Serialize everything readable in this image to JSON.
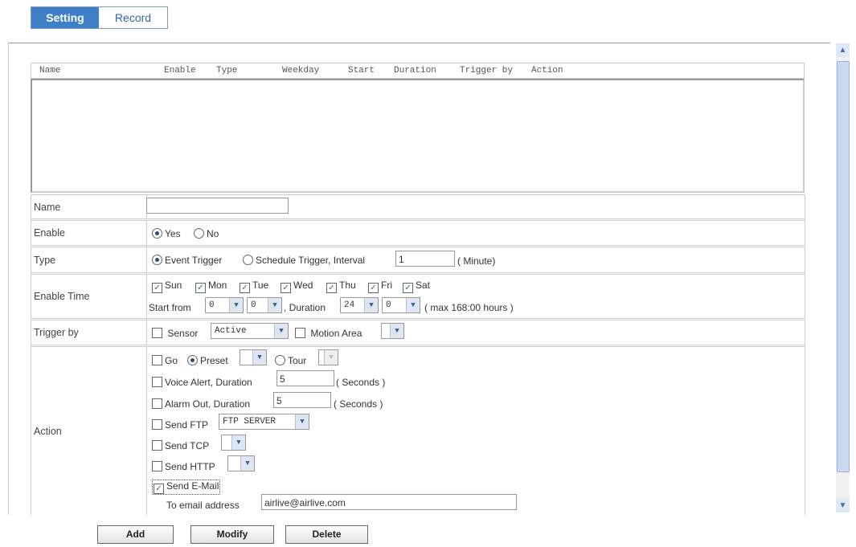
{
  "tabs": {
    "setting": "Setting",
    "record": "Record"
  },
  "list_header": {
    "name": "Name",
    "enable": "Enable",
    "type": "Type",
    "weekday": "Weekday",
    "start": "Start",
    "duration": "Duration",
    "trigger_by": "Trigger by",
    "action": "Action"
  },
  "form": {
    "name": {
      "label": "Name",
      "value": ""
    },
    "enable": {
      "label": "Enable",
      "yes": "Yes",
      "no": "No",
      "selected": "Yes"
    },
    "type": {
      "label": "Type",
      "event": "Event Trigger",
      "schedule": "Schedule Trigger, Interval",
      "interval_value": "1",
      "unit": "( Minute)",
      "selected": "Event Trigger"
    },
    "enable_time": {
      "label": "Enable Time",
      "days": [
        {
          "label": "Sun",
          "checked": true
        },
        {
          "label": "Mon",
          "checked": true
        },
        {
          "label": "Tue",
          "checked": true
        },
        {
          "label": "Wed",
          "checked": true
        },
        {
          "label": "Thu",
          "checked": true
        },
        {
          "label": "Fri",
          "checked": true
        },
        {
          "label": "Sat",
          "checked": true
        }
      ],
      "start_from": "Start from",
      "start_hour": "0",
      "start_min": "0",
      "duration_label": ", Duration",
      "duration_hour": "24",
      "duration_min": "0",
      "max_note": "( max 168:00 hours )"
    },
    "trigger_by": {
      "label": "Trigger by",
      "sensor": "Sensor",
      "sensor_value": "Active",
      "motion": "Motion Area"
    },
    "action": {
      "label": "Action",
      "go": "Go",
      "preset": "Preset",
      "tour": "Tour",
      "voice": "Voice Alert, Duration",
      "voice_value": "5",
      "seconds": "( Seconds )",
      "alarm": "Alarm Out, Duration",
      "alarm_value": "5",
      "ftp": "Send FTP",
      "ftp_value": "FTP SERVER",
      "tcp": "Send TCP",
      "http": "Send HTTP",
      "email": "Send E-Mail",
      "email_addr_label": "To email address",
      "email_addr_value": "airlive@airlive.com"
    }
  },
  "buttons": {
    "add": "Add",
    "modify": "Modify",
    "delete": "Delete"
  },
  "colors": {
    "tab_active": "#3f7fc6",
    "link_blue": "#2f66aa"
  }
}
